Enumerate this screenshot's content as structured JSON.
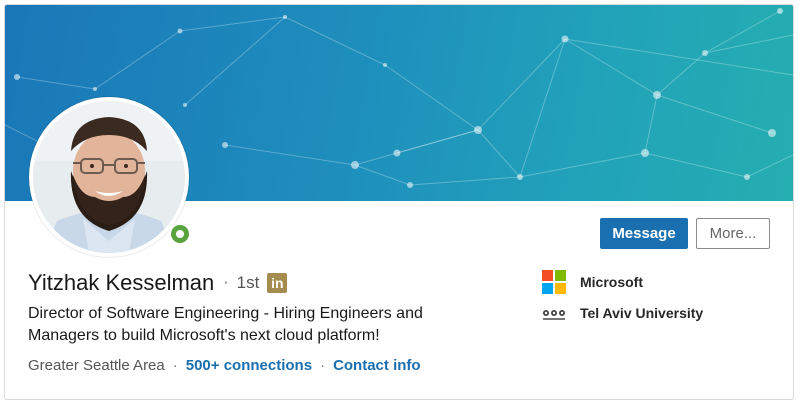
{
  "profile": {
    "name": "Yitzhak Kesselman",
    "separator": "·",
    "degree": "1st",
    "badge": "in",
    "headline": "Director of Software Engineering - Hiring Engineers and Managers to build Microsoft's next cloud platform!",
    "location": "Greater Seattle Area",
    "connections": "500+ connections",
    "contact": "Contact info",
    "online": true
  },
  "actions": {
    "message_label": "Message",
    "more_label": "More..."
  },
  "orgs": [
    {
      "name": "Microsoft",
      "logo": "microsoft-logo"
    },
    {
      "name": "Tel Aviv University",
      "logo": "university-logo"
    }
  ],
  "colors": {
    "primary": "#1a6fb0",
    "banner_start": "#1a77b8",
    "banner_end": "#25aeb0",
    "presence": "#5aa43f",
    "badge": "#a48b4e"
  }
}
